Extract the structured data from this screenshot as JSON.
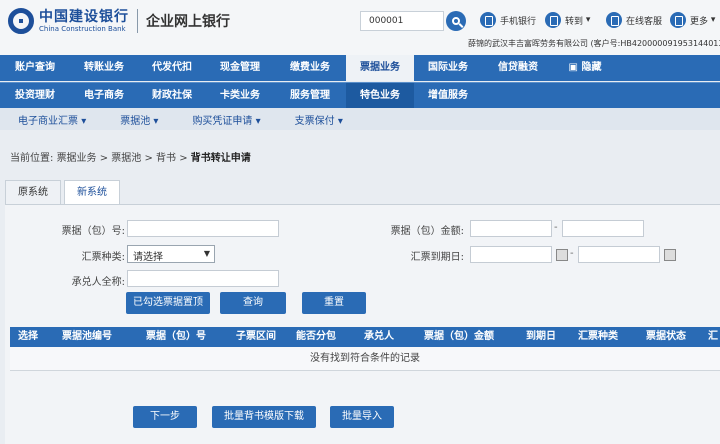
{
  "header": {
    "logo_cn": "中国建设银行",
    "logo_en": "China Construction Bank",
    "logo_sub": "企业网上银行",
    "search_value": "000001",
    "links": [
      "手机银行",
      "转到",
      "在线客服",
      "更多"
    ],
    "customer_info": "薛锦的武汉丰吉富晖劳务有限公司  (客户号:HB420000091953144013)"
  },
  "menu_row1": [
    "账户查询",
    "转账业务",
    "代发代扣",
    "现金管理",
    "缴费业务",
    "票据业务",
    "国际业务",
    "信贷融资",
    "隐藏"
  ],
  "menu_row2": [
    "投资理财",
    "电子商务",
    "财政社保",
    "卡类业务",
    "服务管理",
    "特色业务",
    "增值服务"
  ],
  "submenu": [
    "电子商业汇票",
    "票据池",
    "购买凭证申请",
    "支票保付"
  ],
  "breadcrumb": {
    "prefix": "当前位置:",
    "path": "票据业务  >  票据池  >  背书  >",
    "current": "背书转让申请"
  },
  "tabs": [
    "原系统",
    "新系统"
  ],
  "form": {
    "bill_no_label": "票据（包）号:",
    "bill_amount_label": "票据（包）金额:",
    "bill_type_label": "汇票种类:",
    "bill_type_value": "请选择",
    "due_date_label": "汇票到期日:",
    "acceptor_label": "承兑人全称:",
    "range_sep": "-"
  },
  "buttons": {
    "pin": "已勾选票据置顶",
    "query": "查询",
    "reset": "重置",
    "next": "下一步",
    "batch_download": "批量背书模版下载",
    "batch_import": "批量导入"
  },
  "table": {
    "headers": [
      "选择",
      "票据池编号",
      "票据（包）号",
      "子票区间",
      "能否分包",
      "承兑人",
      "票据（包）金额",
      "到期日",
      "汇票种类",
      "票据状态",
      "汇"
    ],
    "empty": "没有找到符合条件的记录"
  },
  "colors": {
    "brand_blue": "#2a6bb5",
    "dark_blue": "#1d4f9a"
  }
}
